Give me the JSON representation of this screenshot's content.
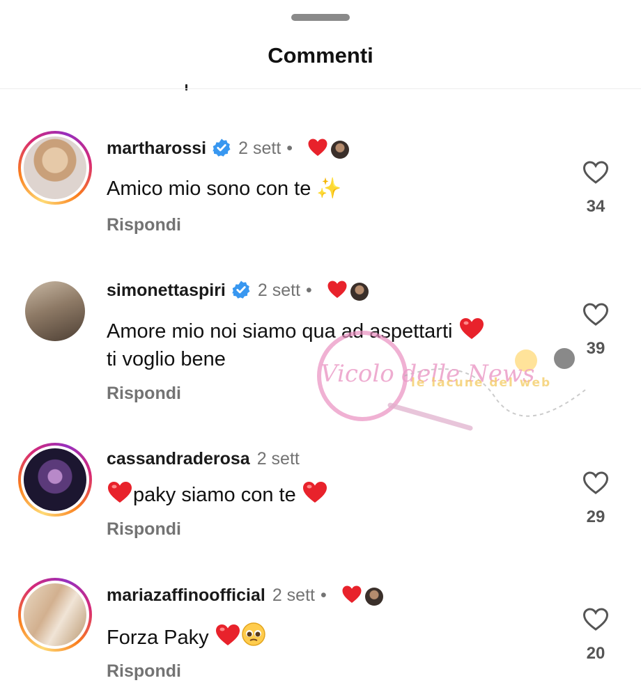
{
  "sheet": {
    "title": "Commenti"
  },
  "comments": [
    {
      "username": "martharossi",
      "verified": true,
      "time": "2 sett",
      "bullet": "•",
      "liked_by_author": true,
      "text": "Amico mio sono con te ✨",
      "reply_label": "Rispondi",
      "likes": "34"
    },
    {
      "username": "simonettaspiri",
      "verified": true,
      "time": "2 sett",
      "bullet": "•",
      "liked_by_author": true,
      "text_line1": "Amore mio noi siamo qua ad aspettarti",
      "text_line2": "ti voglio bene",
      "reply_label": "Rispondi",
      "likes": "39"
    },
    {
      "username": "cassandraderosa",
      "verified": false,
      "time": "2 sett",
      "liked_by_author": false,
      "text": "paky siamo con te",
      "reply_label": "Rispondi",
      "likes": "29"
    },
    {
      "username": "mariazaffinoofficial",
      "verified": false,
      "time": "2 sett",
      "bullet": "•",
      "liked_by_author": true,
      "text": "Forza Paky",
      "reply_label": "Rispondi",
      "likes": "20"
    }
  ],
  "watermark": {
    "text": "Vicolo delle News",
    "tagline": "le lacune del web"
  },
  "colors": {
    "heart_red": "#e8222b",
    "verified_blue": "#3897f0",
    "muted": "#737373"
  }
}
